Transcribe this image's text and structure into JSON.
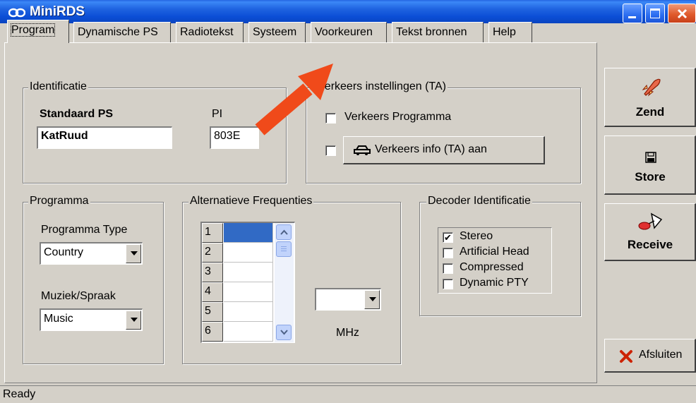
{
  "window": {
    "title": "MiniRDS"
  },
  "tabs": [
    {
      "label": "Program",
      "active": true
    },
    {
      "label": "Dynamische PS"
    },
    {
      "label": "Radiotekst"
    },
    {
      "label": "Systeem"
    },
    {
      "label": "Voorkeuren"
    },
    {
      "label": "Tekst bronnen"
    },
    {
      "label": "Help"
    }
  ],
  "identification": {
    "legend": "Identificatie",
    "ps_label": "Standaard PS",
    "ps_value": "KatRuud",
    "pi_label": "PI",
    "pi_value": "803E"
  },
  "traffic": {
    "legend": "Verkeers instellingen (TA)",
    "tp_label": "Verkeers Programma",
    "tp_checked": false,
    "ta_checked": false,
    "ta_button_label": "Verkeers info (TA) aan"
  },
  "programma": {
    "legend": "Programma",
    "type_label": "Programma Type",
    "type_value": "Country",
    "ms_label": "Muziek/Spraak",
    "ms_value": "Music"
  },
  "af": {
    "legend": "Alternatieve Frequenties",
    "rows": [
      "1",
      "2",
      "3",
      "4",
      "5",
      "6"
    ],
    "freq_value": "",
    "unit": "MHz"
  },
  "decoder": {
    "legend": "Decoder Identificatie",
    "items": [
      {
        "label": "Stereo",
        "checked": true,
        "mark": "✔"
      },
      {
        "label": "Artificial Head",
        "checked": false,
        "mark": ""
      },
      {
        "label": "Compressed",
        "checked": false,
        "mark": ""
      },
      {
        "label": "Dynamic PTY",
        "checked": false,
        "mark": ""
      }
    ]
  },
  "side_buttons": {
    "send": "Zend",
    "store": "Store",
    "receive": "Receive",
    "close": "Afsluiten"
  },
  "status": {
    "text": "Ready"
  },
  "colors": {
    "titlebar": "#0b4ed6",
    "face": "#d4d0c8",
    "annotation_arrow": "#f04a1a",
    "close_x": "#cc2200"
  }
}
